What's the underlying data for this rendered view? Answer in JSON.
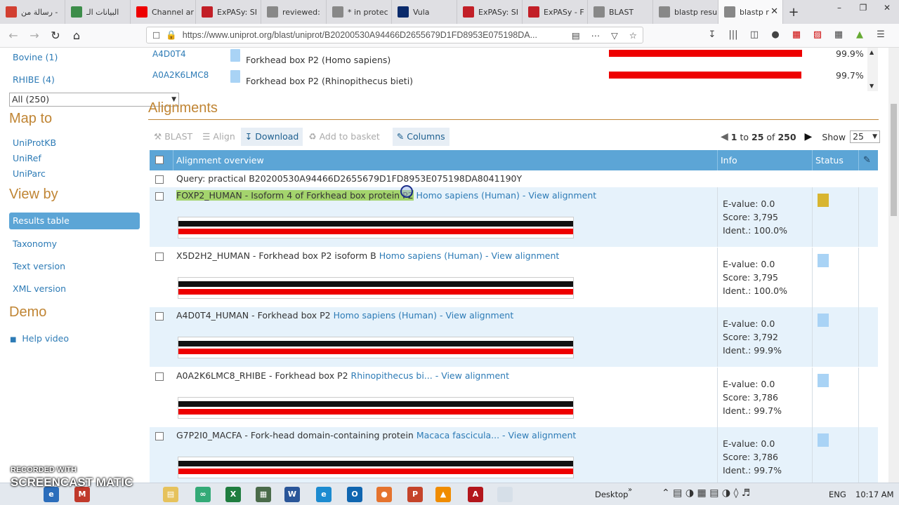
{
  "browser": {
    "tabs": [
      {
        "label": "رسالة من -",
        "icon": "gmail-icon",
        "color": "#d23f31"
      },
      {
        "label": "البيانات الـ",
        "icon": "sheets-icon",
        "color": "#3d8d4a"
      },
      {
        "label": "Channel ar",
        "icon": "youtube-icon",
        "color": "#e00"
      },
      {
        "label": "ExPASy: SI",
        "icon": "expasy-icon",
        "color": "#c21f27"
      },
      {
        "label": "reviewed:",
        "icon": "page-icon",
        "color": "#888"
      },
      {
        "label": "* in protec",
        "icon": "page-icon",
        "color": "#888"
      },
      {
        "label": "Vula",
        "icon": "vula-icon",
        "color": "#0a2a6b"
      },
      {
        "label": "ExPASy: SI",
        "icon": "expasy-icon",
        "color": "#c21f27"
      },
      {
        "label": "ExPASy - F",
        "icon": "expasy-icon",
        "color": "#c21f27"
      },
      {
        "label": "BLAST",
        "icon": "page-icon",
        "color": "#888"
      },
      {
        "label": "blastp resu",
        "icon": "page-icon",
        "color": "#888"
      },
      {
        "label": "blastp r",
        "icon": "loading-icon",
        "color": "#888",
        "active": true
      }
    ],
    "url": "https://www.uniprot.org/blast/uniprot/B20200530A94466D2655679D1FD8953E075198DA..."
  },
  "sidebar": {
    "top_links": [
      "Bovine (1)",
      "RHIBE (4)"
    ],
    "filter_select": "All (250)",
    "map_to_heading": "Map to",
    "map_to": [
      "UniProtKB",
      "UniRef",
      "UniParc"
    ],
    "view_by_heading": "View by",
    "view_by": [
      "Results table",
      "Taxonomy",
      "Text version",
      "XML version"
    ],
    "demo_heading": "Demo",
    "help_video": "Help video"
  },
  "hits_summary": [
    {
      "id": "A4D0T4",
      "desc": "Forkhead box P2 (Homo sapiens)",
      "pct": "99.9%",
      "fill": 0.999
    },
    {
      "id": "A0A2K6LMC8",
      "desc": "Forkhead box P2 (Rhinopithecus bieti)",
      "pct": "99.7%",
      "fill": 0.997
    }
  ],
  "alignments": {
    "heading": "Alignments",
    "toolbar": {
      "blast": "BLAST",
      "align": "Align",
      "download": "Download",
      "basket": "Add to basket",
      "columns": "Columns"
    },
    "pager": {
      "from": "1",
      "to_word": "to",
      "to": "25",
      "of_word": "of",
      "total": "250",
      "show_label": "Show",
      "show_value": "25"
    },
    "columns": {
      "overview": "Alignment overview",
      "info": "Info",
      "status": "Status"
    },
    "query": "Query: practical B20200530A94466D2655679D1FD8953E075198DA8041190Y",
    "rows": [
      {
        "entry": "FOXP2_HUMAN - Isoform 4 of Forkhead box protein P2",
        "organism": "Homo sapiens (Human)",
        "view": "View alignment",
        "evalue": "E-value: 0.0",
        "score": "Score: 3,795",
        "ident": "Ident.: 100.0%",
        "highlight": true
      },
      {
        "entry": "X5D2H2_HUMAN - Forkhead box P2 isoform B",
        "organism": "Homo sapiens (Human)",
        "view": "View alignment",
        "evalue": "E-value: 0.0",
        "score": "Score: 3,795",
        "ident": "Ident.: 100.0%"
      },
      {
        "entry": "A4D0T4_HUMAN - Forkhead box P2",
        "organism": "Homo sapiens (Human)",
        "view": "View alignment",
        "evalue": "E-value: 0.0",
        "score": "Score: 3,792",
        "ident": "Ident.: 99.9%"
      },
      {
        "entry": "A0A2K6LMC8_RHIBE - Forkhead box P2 ",
        "organism": "Rhinopithecus bi...",
        "view": "View alignment",
        "evalue": "E-value: 0.0",
        "score": "Score: 3,786",
        "ident": "Ident.: 99.7%"
      },
      {
        "entry": "G7P2I0_MACFA - Fork-head domain-containing protein ",
        "organism": "Macaca fascicula...",
        "view": "View alignment",
        "evalue": "E-value: 0.0",
        "score": "Score: 3,786",
        "ident": "Ident.: 99.7%"
      }
    ]
  },
  "taskbar": {
    "desktop": "Desktop",
    "lang": "ENG",
    "time": "10:17 AM"
  },
  "watermark": {
    "line1": "RECORDED WITH",
    "line2": "SCREENCAST MATIC"
  }
}
